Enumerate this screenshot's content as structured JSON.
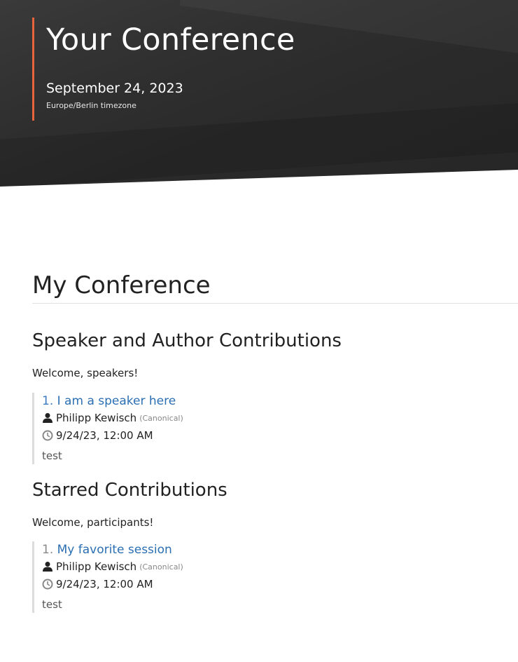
{
  "header": {
    "title": "Your Conference",
    "date": "September 24, 2023",
    "timezone": "Europe/Berlin timezone",
    "accent_color": "#e8643c"
  },
  "page": {
    "title": "My Conference"
  },
  "sections": [
    {
      "title": "Speaker and Author Contributions",
      "intro": "Welcome, speakers!",
      "contribution": {
        "number": "1.",
        "title": "I am a speaker here",
        "speaker": "Philipp Kewisch",
        "affiliation": "(Canonical)",
        "time": "9/24/23, 12:00 AM",
        "description": "test"
      }
    },
    {
      "title": "Starred Contributions",
      "intro": "Welcome, participants!",
      "contribution": {
        "number": "1.",
        "title": "My favorite session",
        "speaker": "Philipp Kewisch",
        "affiliation": "(Canonical)",
        "time": "9/24/23, 12:00 AM",
        "description": "test"
      }
    }
  ],
  "icons": {
    "speaker": "person-icon",
    "time": "clock-icon"
  },
  "colors": {
    "link": "#2b6fb3",
    "header_bg": "#2e2e2e"
  }
}
